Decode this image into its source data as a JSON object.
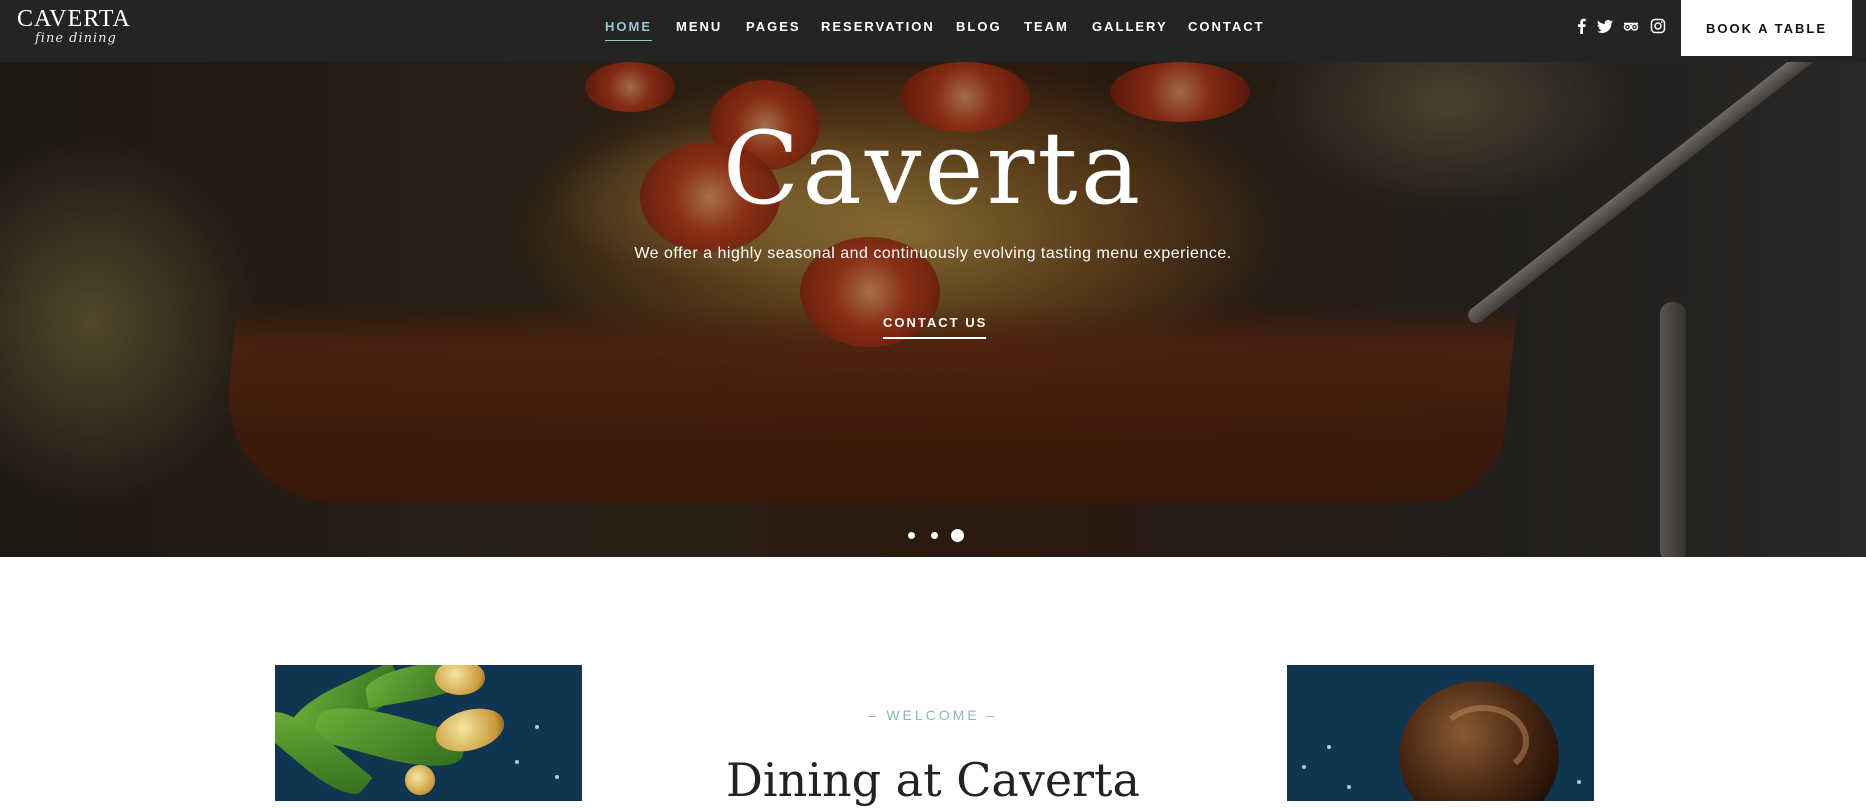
{
  "header": {
    "logo": {
      "name": "CAVERTA",
      "tagline": "fine dining"
    },
    "nav": [
      {
        "label": "HOME",
        "active": true
      },
      {
        "label": "MENU",
        "active": false
      },
      {
        "label": "PAGES",
        "active": false
      },
      {
        "label": "RESERVATION",
        "active": false
      },
      {
        "label": "BLOG",
        "active": false
      },
      {
        "label": "TEAM",
        "active": false
      },
      {
        "label": "GALLERY",
        "active": false
      },
      {
        "label": "CONTACT",
        "active": false
      }
    ],
    "social_icons": [
      "facebook-icon",
      "twitter-icon",
      "tripadvisor-icon",
      "instagram-icon"
    ],
    "cta_label": "BOOK A TABLE"
  },
  "hero": {
    "title": "Caverta",
    "subtitle": "We offer a highly seasonal and continuously evolving tasting menu experience.",
    "cta_label": "CONTACT US",
    "slides_total": 3,
    "active_slide": 3
  },
  "welcome": {
    "eyebrow": "– WELCOME –",
    "title": "Dining at Caverta"
  },
  "colors": {
    "header_bg": "#242424",
    "accent": "#9ac6d4",
    "eyebrow": "#8fb3c2",
    "photo_bg": "#0f3550"
  }
}
